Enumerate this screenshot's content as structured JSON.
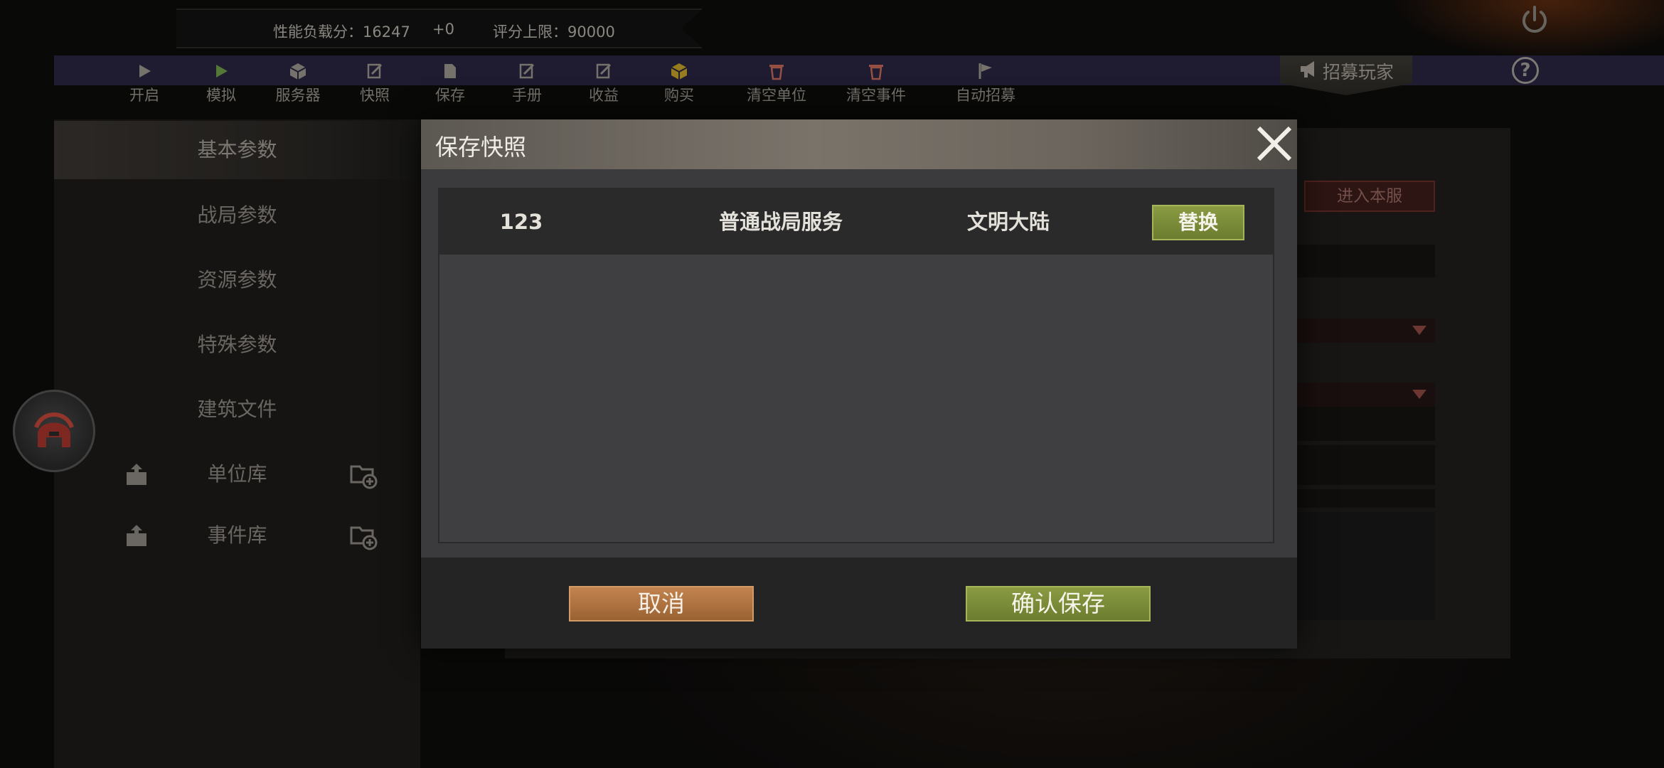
{
  "status_bar": {
    "load_text": "性能负载分：16247",
    "delta_text": "+0",
    "limit_text": "评分上限：90000"
  },
  "toolbar": {
    "items": [
      {
        "label": "开启",
        "icon": "play-icon"
      },
      {
        "label": "模拟",
        "icon": "play-green-icon"
      },
      {
        "label": "服务器",
        "icon": "cube-icon"
      },
      {
        "label": "快照",
        "icon": "edit-icon"
      },
      {
        "label": "保存",
        "icon": "document-icon"
      },
      {
        "label": "手册",
        "icon": "edit-icon"
      },
      {
        "label": "收益",
        "icon": "edit-icon"
      },
      {
        "label": "购买",
        "icon": "cube-yellow-icon"
      },
      {
        "label": "清空单位",
        "icon": "trash-icon"
      },
      {
        "label": "清空事件",
        "icon": "trash-icon"
      },
      {
        "label": "自动招募",
        "icon": "flag-icon"
      }
    ],
    "recruit_label": "招募玩家",
    "help_label": "?"
  },
  "sidebar": {
    "items": [
      {
        "label": "基本参数",
        "active": true
      },
      {
        "label": "战局参数",
        "active": false
      },
      {
        "label": "资源参数",
        "active": false
      },
      {
        "label": "特殊参数",
        "active": false
      },
      {
        "label": "建筑文件",
        "active": false
      }
    ],
    "libraries": [
      {
        "label": "单位库"
      },
      {
        "label": "事件库"
      }
    ]
  },
  "background_panel": {
    "enter_label": "进入本服"
  },
  "modal": {
    "title": "保存快照",
    "rows": [
      {
        "id": "123",
        "type": "普通战局服务",
        "map": "文明大陆",
        "action": "替换"
      }
    ],
    "cancel_label": "取消",
    "confirm_label": "确认保存"
  },
  "colors": {
    "toolbar_bg": "#2a2540",
    "confirm_green": "#7a8b3a",
    "cancel_orange": "#b07543",
    "modal_bg": "#3b3b3d"
  }
}
